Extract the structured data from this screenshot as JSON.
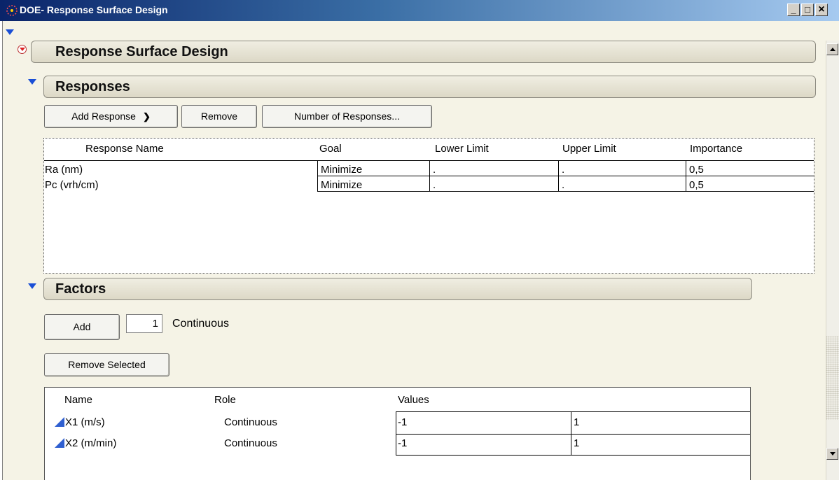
{
  "window": {
    "title": "DOE- Response Surface Design",
    "minimize": "_",
    "maximize": "□",
    "close": "×"
  },
  "main_header": {
    "title": "Response Surface Design"
  },
  "responses": {
    "title": "Responses",
    "add_response_label": "Add Response",
    "remove_label": "Remove",
    "number_label": "Number of Responses...",
    "columns": [
      "Response Name",
      "Goal",
      "Lower Limit",
      "Upper Limit",
      "Importance"
    ],
    "rows": [
      {
        "name": "Ra (nm)",
        "goal": "Minimize",
        "lower": ".",
        "upper": ".",
        "importance": "0,5"
      },
      {
        "name": "Pc (vrh/cm)",
        "goal": "Minimize",
        "lower": ".",
        "upper": ".",
        "importance": "0,5"
      }
    ]
  },
  "factors": {
    "title": "Factors",
    "add_label": "Add",
    "count_value": "1",
    "type_label": "Continuous",
    "remove_selected_label": "Remove Selected",
    "columns": [
      "Name",
      "Role",
      "Values"
    ],
    "rows": [
      {
        "name": "X1 (m/s)",
        "role": "Continuous",
        "low": "-1",
        "high": "1"
      },
      {
        "name": "X2 (m/min)",
        "role": "Continuous",
        "low": "-1",
        "high": "1"
      }
    ]
  },
  "colors": {
    "background": "#f5f3e6",
    "title_bar": "#0a246a",
    "disclosure": "#1a4fd6",
    "factor_icon": "#2f5fd0"
  },
  "icons": [
    "app-icon",
    "disclosure-triangle-icon",
    "red-triangle-menu-icon",
    "continuous-factor-icon",
    "chevron-down-icon",
    "scroll-up-icon",
    "scroll-down-icon"
  ]
}
